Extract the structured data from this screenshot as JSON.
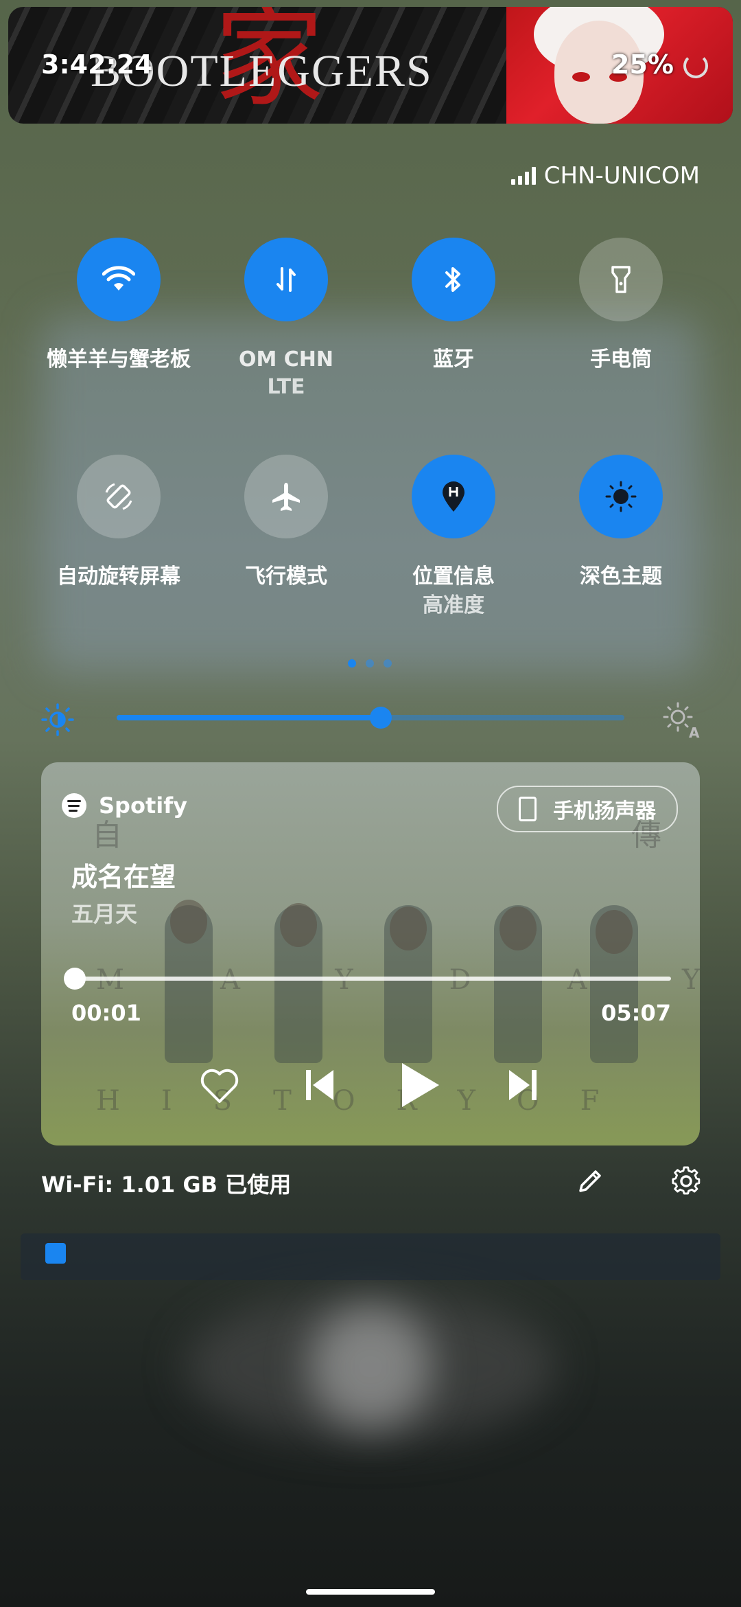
{
  "status_bar": {
    "time": "3:42:24",
    "battery": "25%",
    "banner_brand": "BOOTLEGGERS",
    "banner_kanji": "家"
  },
  "carrier": "CHN-UNICOM",
  "quick_tiles": [
    {
      "label": "懒羊羊与蟹老板",
      "sub": "",
      "icon": "wifi-icon",
      "state": "on"
    },
    {
      "label": "OM      CHN",
      "sub": "LTE",
      "icon": "mobile-data-icon",
      "state": "on"
    },
    {
      "label": "蓝牙",
      "sub": "",
      "icon": "bluetooth-icon",
      "state": "on"
    },
    {
      "label": "手电筒",
      "sub": "",
      "icon": "flashlight-icon",
      "state": "off"
    },
    {
      "label": "自动旋转屏幕",
      "sub": "",
      "icon": "auto-rotate-icon",
      "state": "off"
    },
    {
      "label": "飞行模式",
      "sub": "",
      "icon": "airplane-icon",
      "state": "off"
    },
    {
      "label": "位置信息",
      "sub": "高准度",
      "icon": "location-icon",
      "state": "on"
    },
    {
      "label": "深色主题",
      "sub": "",
      "icon": "dark-theme-icon",
      "state": "on"
    }
  ],
  "page_indicator": {
    "pages": 3,
    "active": 0
  },
  "brightness": {
    "level": 0.52
  },
  "media": {
    "app": "Spotify",
    "output_device": "手机扬声器",
    "title": "成名在望",
    "artist": "五月天",
    "elapsed": "00:01",
    "duration": "05:07",
    "progress": 0.003
  },
  "footer": {
    "data_usage": "Wi-Fi: 1.01 GB 已使用"
  },
  "colors": {
    "accent": "#1a85f0",
    "tile_off": "rgba(255,255,255,0.22)"
  }
}
